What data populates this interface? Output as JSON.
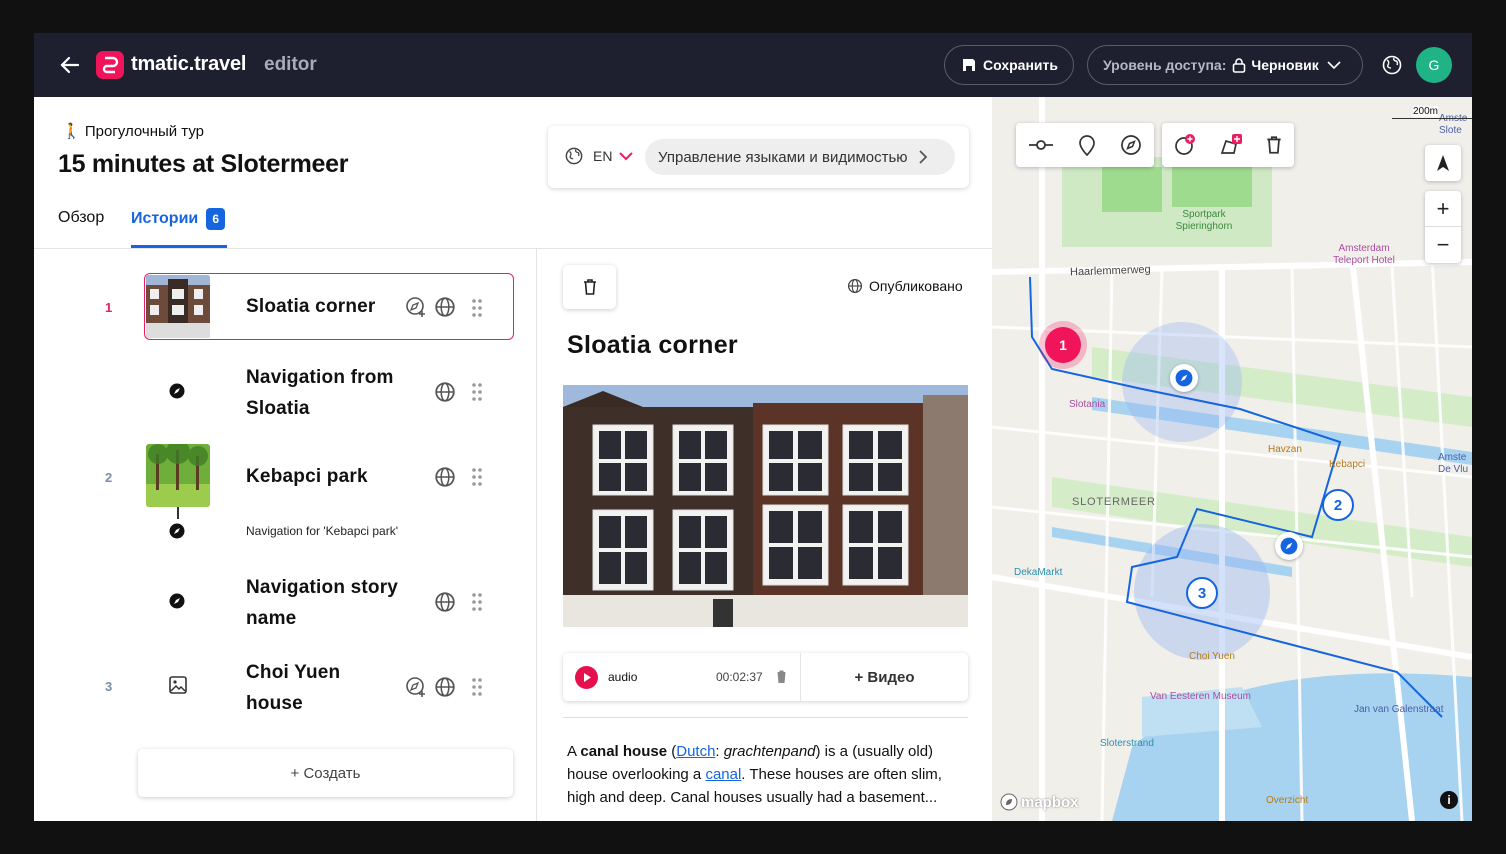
{
  "header": {
    "logo_text": "tmatic.travel",
    "editor_label": "editor",
    "save_label": "Сохранить",
    "access_label": "Уровень доступа:",
    "access_value": "Черновик",
    "avatar_letter": "G"
  },
  "tour": {
    "type_label": "🚶 Прогулочный тур",
    "title": "15 minutes at Slotermeer",
    "lang_code": "EN",
    "lang_manage_label": "Управление языками и видимостью",
    "tabs": [
      {
        "label": "Обзор"
      },
      {
        "label": "Истории",
        "badge": "6"
      }
    ]
  },
  "stories": [
    {
      "num": "1",
      "title_lines": [
        "Sloatia corner"
      ]
    },
    {
      "num": "",
      "title_lines": [
        "Navigation from",
        "Sloatia"
      ]
    },
    {
      "num": "2",
      "title_lines": [
        "Kebapci park"
      ],
      "sub": "Navigation for 'Kebapci park'"
    },
    {
      "num": "",
      "title_lines": [
        "Navigation story",
        "name"
      ]
    },
    {
      "num": "3",
      "title_lines": [
        "Choi Yuen",
        "house"
      ]
    }
  ],
  "create_label": "+ Создать",
  "detail": {
    "status_label": "Опубликовано",
    "title": "Sloatia corner",
    "audio_label": "audio",
    "audio_time": "00:02:37",
    "video_label": "+ Видео",
    "text_parts": {
      "p1": "A ",
      "b1": "canal house",
      "p2": " (",
      "l1": "Dutch",
      "p3": ": ",
      "i1": "grachtenpand",
      "p4": ") is a (usually old) house overlooking a ",
      "l2": "canal",
      "p5": ". These houses are often slim, high and deep. Canal houses usually had a basement..."
    }
  },
  "map": {
    "scale_label": "200m",
    "labels": {
      "sportpark": "Sportpark Spieringhorn",
      "teleport": "Amsterdam Teleport Hotel",
      "haarlemmerweg": "Haarlemmerweg",
      "slotania": "Slotania",
      "havzan": "Havzan",
      "kebapci": "Kebapci",
      "slotermeer": "SLOTERMEER",
      "dekamarkt": "DekaMarkt",
      "choiyuen": "Choi Yuen",
      "vaneesteren": "Van Eesteren Museum",
      "janvangalen": "Jan van Galenstraat",
      "sloterstrand": "Sloterstrand",
      "overzicht": "Overzicht",
      "amsterdam_devlu": "Amste De Vlu",
      "amste_slote": "Amste Slote"
    },
    "markers": [
      "1",
      "2",
      "3"
    ],
    "attribution": "mapbox"
  },
  "colors": {
    "accent": "#e91e63",
    "blue": "#1565e0",
    "topbar": "#1e1f2f"
  }
}
